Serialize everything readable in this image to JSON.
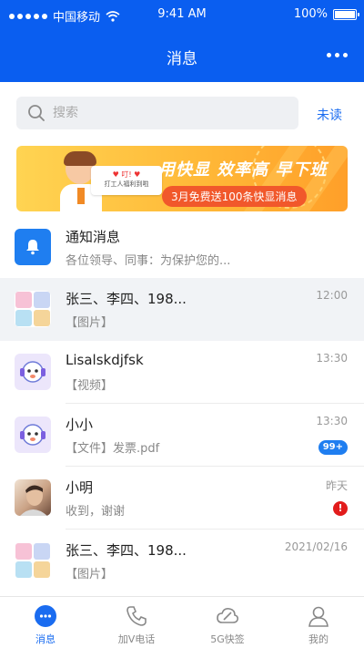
{
  "status_bar": {
    "carrier": "中国移动",
    "time": "9:41 AM",
    "battery": "100%"
  },
  "header": {
    "title": "消息",
    "more_icon": "more-icon"
  },
  "search": {
    "placeholder": "搜索",
    "unread_label": "未读"
  },
  "banner": {
    "headline": "用快显 效率高 早下班",
    "promo": "3月免费送100条快显消息",
    "card_ding": "♥ 叮! ♥",
    "card_text": "打工人福利到啦"
  },
  "conversations": [
    {
      "name": "通知消息",
      "preview": "各位领导、同事：为保护您的...",
      "time": "",
      "avatar": "bell-icon"
    },
    {
      "name": "张三、李四、198...",
      "preview": "【图片】",
      "time": "12:00",
      "avatar": "group-avatar"
    },
    {
      "name": "Lisalskdjfsk",
      "preview": "【视频】",
      "time": "13:30",
      "avatar": "mascot-avatar"
    },
    {
      "name": "小小",
      "preview": "【文件】发票.pdf",
      "time": "13:30",
      "avatar": "mascot-avatar",
      "badge": "99+"
    },
    {
      "name": "小明",
      "preview": "收到，谢谢",
      "time": "昨天",
      "avatar": "photo-avatar",
      "alert": "!"
    },
    {
      "name": "张三、李四、198...",
      "preview": "【图片】",
      "time": "2021/02/16",
      "avatar": "group-avatar"
    }
  ],
  "tabs": [
    {
      "label": "消息",
      "icon": "chat-bubble-icon",
      "active": true
    },
    {
      "label": "加V电话",
      "icon": "phone-icon",
      "active": false
    },
    {
      "label": "5G快签",
      "icon": "cloud-sign-icon",
      "active": false
    },
    {
      "label": "我的",
      "icon": "user-icon",
      "active": false
    }
  ],
  "colors": {
    "primary": "#0a5ef0",
    "accent": "#1a6cf0",
    "alert": "#e21c1c",
    "banner": "#ffb938"
  }
}
